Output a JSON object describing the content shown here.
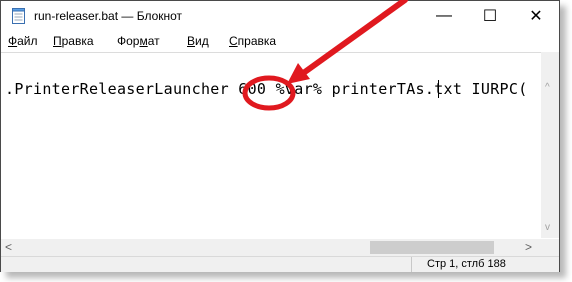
{
  "window": {
    "title": "run-releaser.bat — Блокнот",
    "minimize_symbol": "—",
    "maximize_symbol": "☐",
    "close_symbol": "✕"
  },
  "menu": {
    "items": [
      {
        "underlined": "Ф",
        "rest": "айл"
      },
      {
        "underlined": "П",
        "rest": "равка"
      },
      {
        "pre": "Фор",
        "underlined": "м",
        "rest": "ат"
      },
      {
        "underlined": "В",
        "rest": "ид"
      },
      {
        "underlined": "С",
        "rest": "правка"
      }
    ]
  },
  "editor": {
    "text": ".PrinterReleaserLauncher 600 %var% printerTAs.txt IURPC("
  },
  "scrollbar": {
    "up_arrow": "^",
    "down_arrow": "v",
    "left_arrow": "<",
    "right_arrow": ">"
  },
  "status": {
    "position": "Стр 1, стлб 188"
  },
  "annotation": {
    "arrow_color": "#e0191f",
    "circle_color": "#e0191f"
  },
  "icons": {
    "app": "notepad-icon"
  }
}
